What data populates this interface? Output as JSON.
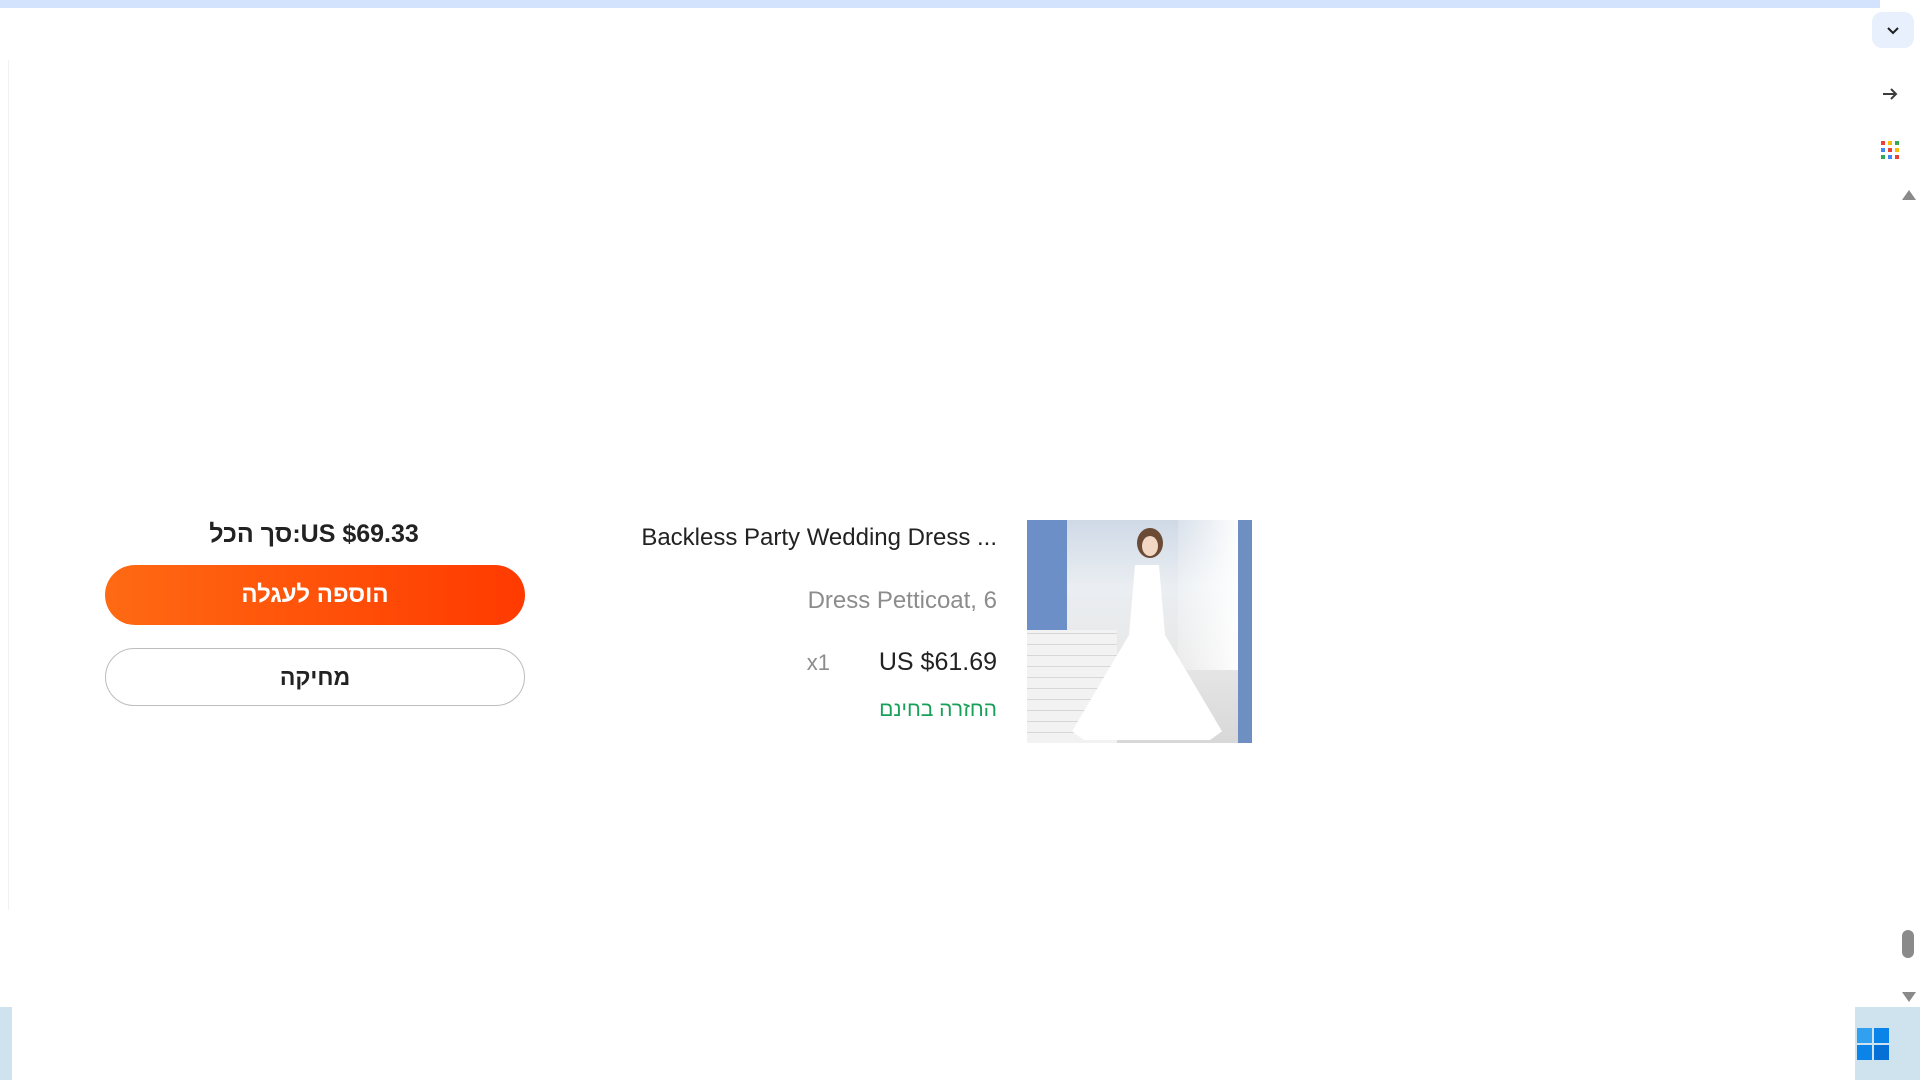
{
  "product": {
    "title": "Backless Party Wedding Dress ...",
    "variant": "Dress Petticoat, 6",
    "price": "US $61.69",
    "quantity": "x1",
    "free_return": "החזרה בחינם",
    "image_alt": "flower girl wedding dress"
  },
  "summary": {
    "total": "סך הכל:US $69.33",
    "add_to_cart": "הוספה לעגלה",
    "delete": "מחיקה"
  },
  "colors": {
    "primary_button": "#ff4a0a",
    "free_return_text": "#18a058"
  },
  "browser": {
    "icons": [
      "chevron-down-icon",
      "arrow-right-icon",
      "apps-grid-icon"
    ]
  }
}
